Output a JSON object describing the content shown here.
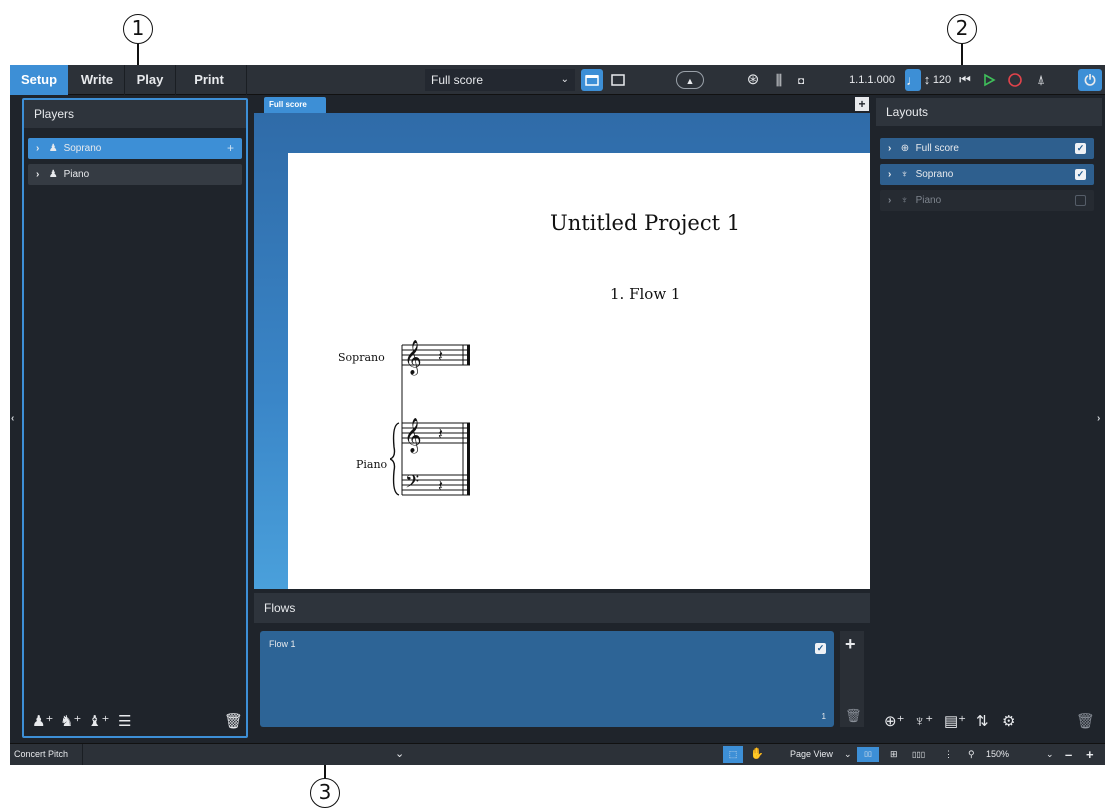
{
  "callouts": [
    "1",
    "2",
    "3"
  ],
  "toolbar": {
    "modes": [
      "Setup",
      "Write",
      "Play",
      "Print"
    ],
    "layout_selector": "Full score",
    "position": "1.1.1.000",
    "tempo": "120"
  },
  "players_panel": {
    "title": "Players",
    "players": [
      {
        "label": "Soprano",
        "icon": "person-icon",
        "selected": true
      },
      {
        "label": "Piano",
        "icon": "person-icon",
        "selected": false
      }
    ]
  },
  "score": {
    "tab_label": "Full score",
    "title": "Untitled Project 1",
    "flow_heading": "1. Flow 1",
    "staff_labels": [
      "Soprano",
      "Piano"
    ]
  },
  "layouts_panel": {
    "title": "Layouts",
    "layouts": [
      {
        "label": "Full score",
        "icon": "full-score-icon",
        "checked": true
      },
      {
        "label": "Soprano",
        "icon": "part-icon",
        "checked": true
      },
      {
        "label": "Piano",
        "icon": "part-icon",
        "checked": false
      }
    ]
  },
  "flows_panel": {
    "title": "Flows",
    "flows": [
      {
        "label": "Flow 1",
        "number": "1",
        "checked": true
      }
    ]
  },
  "statusbar": {
    "concert_pitch": "Concert Pitch",
    "view_mode": "Page View",
    "zoom": "150%"
  },
  "colors": {
    "accent": "#3d8fd6",
    "panel_bg": "#1f242b",
    "selected_row": "#3d8fd6",
    "flow_card": "#2d6496",
    "play_green": "#3fbf5a",
    "record_red": "#e0434b"
  }
}
